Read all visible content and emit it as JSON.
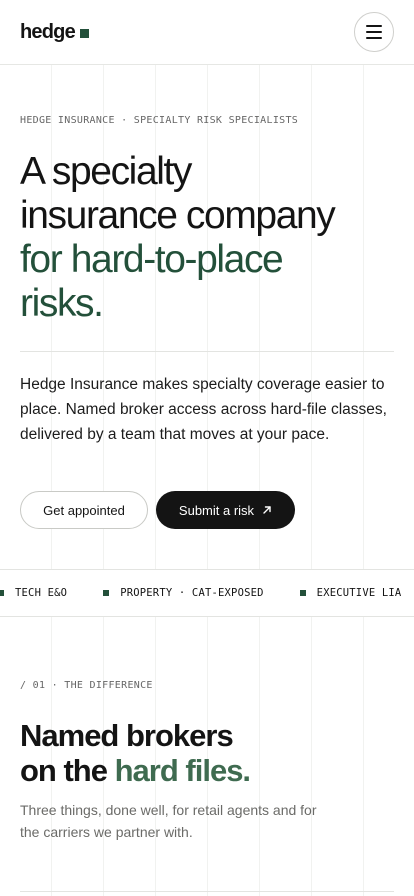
{
  "header": {
    "logo_text": "hedge",
    "menu_icon": "hamburger-menu-icon",
    "brand_color": "#23503a"
  },
  "hero": {
    "eyebrow": "HEDGE INSURANCE · SPECIALTY RISK SPECIALISTS",
    "headline": {
      "line1": "A specialty",
      "line2": "insurance company",
      "line3": "for hard-to-place",
      "line4": "risks."
    },
    "intro": "Hedge Insurance makes specialty coverage easier to place. Named broker access across hard-file classes, delivered by a team that moves at your pace.",
    "buttons": {
      "secondary_label": "Get appointed",
      "primary_label": "Submit a risk",
      "primary_icon": "arrow-up-right-icon"
    }
  },
  "marquee": {
    "items": [
      "TECH E&O",
      "PROPERTY · CAT-EXPOSED",
      "EXECUTIVE LIA"
    ]
  },
  "difference": {
    "eyebrow": "/ 01 · THE DIFFERENCE",
    "title_line1": "Named brokers",
    "title_line2_plain": "on the ",
    "title_line2_accent": "hard files.",
    "subtitle": "Three things, done well, for retail agents and for the carriers we partner with."
  },
  "colors": {
    "accent_green": "#23503a",
    "accent_green_light": "#3f6b50",
    "dark_button": "#141414"
  }
}
